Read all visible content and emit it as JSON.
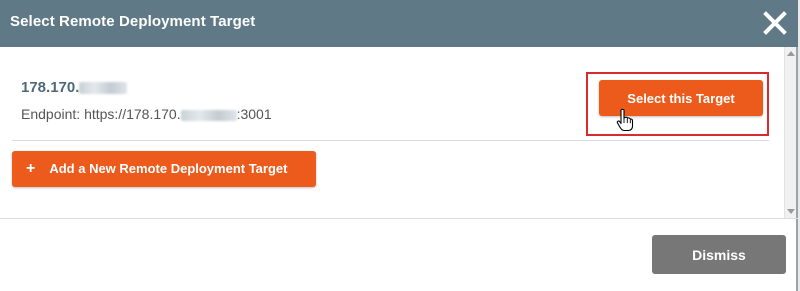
{
  "dialog": {
    "title": "Select Remote Deployment Target",
    "close_icon": "close-icon"
  },
  "target": {
    "ip_prefix": "178.170.",
    "endpoint_label": "Endpoint: ",
    "endpoint_prefix": "https://178.170.",
    "endpoint_suffix": ":3001",
    "select_label": "Select this Target"
  },
  "add_target": {
    "plus": "+",
    "label": "Add a New Remote Deployment Target"
  },
  "footer": {
    "dismiss_label": "Dismiss"
  },
  "colors": {
    "header": "#5f7a86",
    "accent": "#ec5a1c",
    "highlight": "#d92b2b",
    "dismiss": "#777777"
  }
}
